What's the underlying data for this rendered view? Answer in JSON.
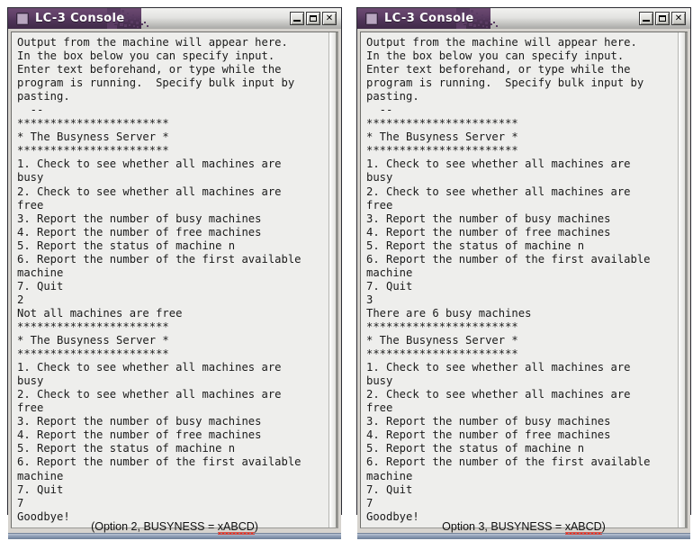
{
  "window": {
    "title": "LC-3 Console",
    "app_icon": "app-square-icon",
    "controls": {
      "minimize_label": "–",
      "maximize_label": "□",
      "close_label": "✕"
    }
  },
  "panels": [
    {
      "id": "left",
      "caption": {
        "prefix": "(Option 2, BUSYNESS = ",
        "misspelled": "xABCD",
        "suffix": ")"
      },
      "console_text": "Output from the machine will appear here.\nIn the box below you can specify input.\nEnter text beforehand, or type while the\nprogram is running.  Specify bulk input by\npasting.\n  --\n***********************\n* The Busyness Server *\n***********************\n1. Check to see whether all machines are\nbusy\n2. Check to see whether all machines are\nfree\n3. Report the number of busy machines\n4. Report the number of free machines\n5. Report the status of machine n\n6. Report the number of the first available\nmachine\n7. Quit\n2\nNot all machines are free\n***********************\n* The Busyness Server *\n***********************\n1. Check to see whether all machines are\nbusy\n2. Check to see whether all machines are\nfree\n3. Report the number of busy machines\n4. Report the number of free machines\n5. Report the status of machine n\n6. Report the number of the first available\nmachine\n7. Quit\n7\nGoodbye!"
    },
    {
      "id": "right",
      "caption": {
        "prefix": "Option 3, BUSYNESS = ",
        "misspelled": "xABCD",
        "suffix": ")"
      },
      "console_text": "Output from the machine will appear here.\nIn the box below you can specify input.\nEnter text beforehand, or type while the\nprogram is running.  Specify bulk input by\npasting.\n  --\n***********************\n* The Busyness Server *\n***********************\n1. Check to see whether all machines are\nbusy\n2. Check to see whether all machines are\nfree\n3. Report the number of busy machines\n4. Report the number of free machines\n5. Report the status of machine n\n6. Report the number of the first available\nmachine\n7. Quit\n3\nThere are 6 busy machines\n***********************\n* The Busyness Server *\n***********************\n1. Check to see whether all machines are\nbusy\n2. Check to see whether all machines are\nfree\n3. Report the number of busy machines\n4. Report the number of free machines\n5. Report the status of machine n\n6. Report the number of the first available\nmachine\n7. Quit\n7\nGoodbye!"
    }
  ],
  "colors": {
    "titlebar_purple": "#4e3357",
    "console_bg": "#eeeeec",
    "window_chrome": "#d6d3ce",
    "bottom_strip": "#8a9ab2",
    "spellcheck_red": "#e02b1d"
  }
}
